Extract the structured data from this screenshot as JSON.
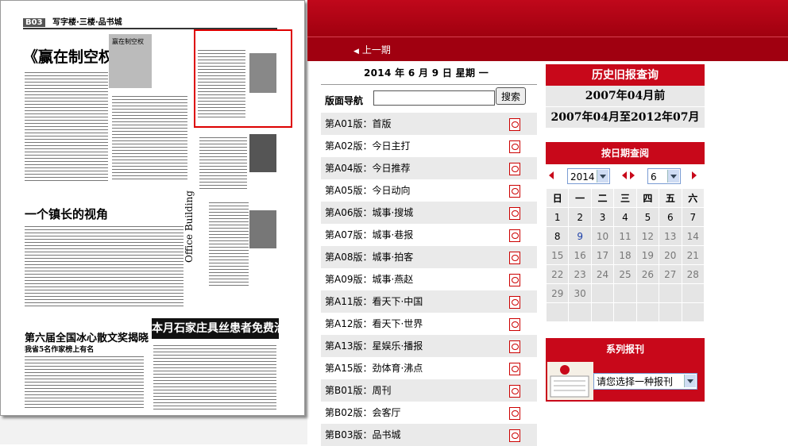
{
  "header": {
    "prev_label": "上一期"
  },
  "paper": {
    "page_header": "写字楼·三楼·品书城",
    "page_no": "B03",
    "headline1": "《赢在制空权》",
    "book_title": "赢在制空权",
    "headline2": "一个镇长的视角",
    "headline3": "第六届全国冰心散文奖揭晓",
    "headline3_sub": "我省5名作家榜上有名",
    "banner": "本月石家庄具丝患者免费治",
    "vertical": "Office Building"
  },
  "date": {
    "year": "2014",
    "month": "6",
    "day": "9",
    "weekday": "一",
    "text": "2014 年 6 月 9 日   星期 一"
  },
  "nav": {
    "label": "版面导航",
    "search_placeholder": "",
    "search_button": "搜索",
    "items": [
      "第A01版：首版",
      "第A02版：今日主打",
      "第A04版：今日推荐",
      "第A05版：今日动向",
      "第A06版：城事·搜城",
      "第A07版：城事·巷报",
      "第A08版：城事·拍客",
      "第A09版：城事·燕赵",
      "第A11版：看天下·中国",
      "第A12版：看天下·世界",
      "第A13版：星娱乐·播报",
      "第A15版：劲体育·沸点",
      "第B01版：周刊",
      "第B02版：会客厅",
      "第B03版：品书城"
    ]
  },
  "history": {
    "title": "历史旧报查询",
    "link1": "2007年04月前",
    "link2": "2007年04月至2012年07月"
  },
  "calendar": {
    "title": "按日期查阅",
    "year": "2014",
    "month": "6",
    "weekdays": [
      "日",
      "一",
      "二",
      "三",
      "四",
      "五",
      "六"
    ],
    "weeks": [
      [
        "1",
        "2",
        "3",
        "4",
        "5",
        "6",
        "7"
      ],
      [
        "8",
        "9",
        "10",
        "11",
        "12",
        "13",
        "14"
      ],
      [
        "15",
        "16",
        "17",
        "18",
        "19",
        "20",
        "21"
      ],
      [
        "22",
        "23",
        "24",
        "25",
        "26",
        "27",
        "28"
      ],
      [
        "29",
        "30",
        "",
        "",
        "",
        "",
        ""
      ],
      [
        "",
        "",
        "",
        "",
        "",
        "",
        ""
      ]
    ]
  },
  "series": {
    "title": "系列报刊",
    "select_value": "请您选择一种报刊"
  },
  "colors": {
    "brand_red": "#c8081a",
    "row_alt": "#eaeaea",
    "link_blue": "#1c3fa8"
  }
}
